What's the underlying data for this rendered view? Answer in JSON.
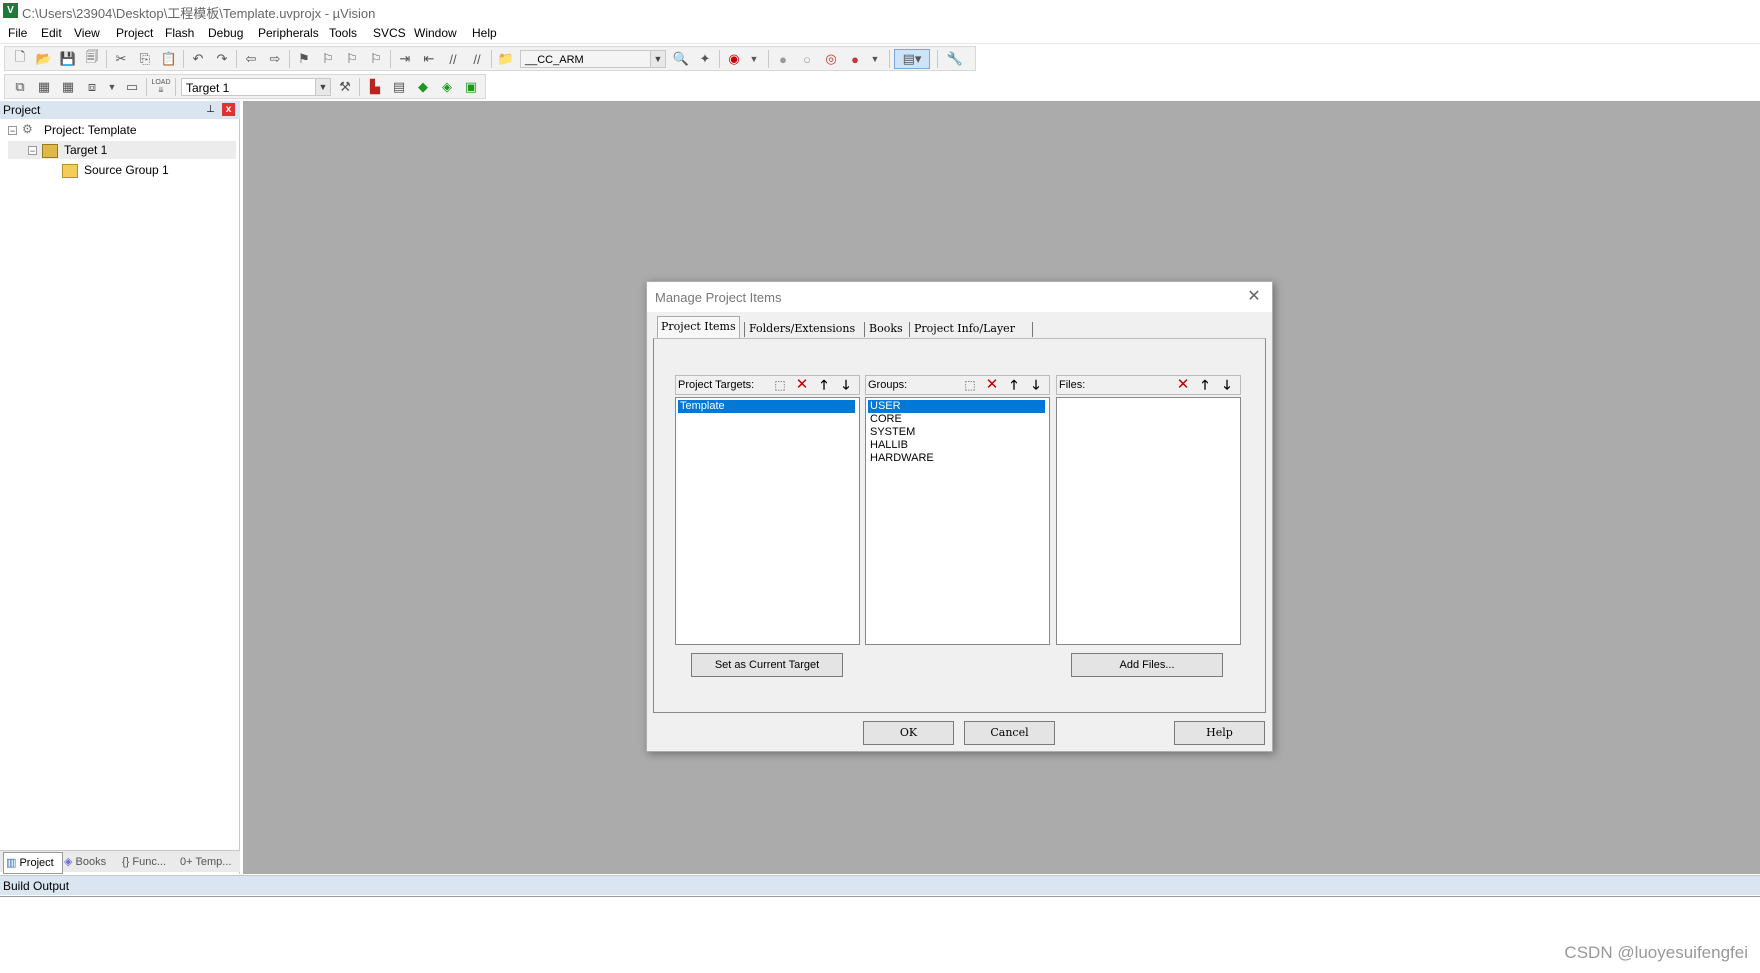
{
  "window": {
    "title": "C:\\Users\\23904\\Desktop\\工程模板\\Template.uvprojx - µVision",
    "app_icon": "V"
  },
  "menu": [
    "File",
    "Edit",
    "View",
    "Project",
    "Flash",
    "Debug",
    "Peripherals",
    "Tools",
    "SVCS",
    "Window",
    "Help"
  ],
  "toolbar1": {
    "define_combo": "__CC_ARM"
  },
  "toolbar2": {
    "target_combo": "Target 1",
    "load_label": "LOAD"
  },
  "project_panel": {
    "header": "Project",
    "pin_icon": "📌",
    "close_icon": "x",
    "tree": {
      "project": "Project: Template",
      "target": "Target 1",
      "group": "Source Group 1"
    },
    "tabs": [
      "Project",
      "Books",
      "{} Func...",
      "0+ Temp..."
    ]
  },
  "build_output": {
    "header": "Build Output"
  },
  "watermark": "CSDN @luoyesuifengfei",
  "dialog": {
    "title": "Manage Project Items",
    "close": "✕",
    "tabs": [
      "Project Items",
      "Folders/Extensions",
      "Books",
      "Project Info/Layer"
    ],
    "active_tab": "Project Items",
    "targets": {
      "label": "Project Targets:",
      "items": [
        "Template"
      ],
      "selected": 0
    },
    "groups": {
      "label": "Groups:",
      "items": [
        "USER",
        "CORE",
        "SYSTEM",
        "HALLIB",
        "HARDWARE"
      ],
      "selected": 0
    },
    "files": {
      "label": "Files:",
      "items": []
    },
    "buttons": {
      "set_current": "Set as Current Target",
      "add_files": "Add Files...",
      "ok": "OK",
      "cancel": "Cancel",
      "help": "Help"
    },
    "icons": {
      "new": "⬚",
      "delete": "✕",
      "up": "🡑",
      "down": "🡓"
    }
  }
}
